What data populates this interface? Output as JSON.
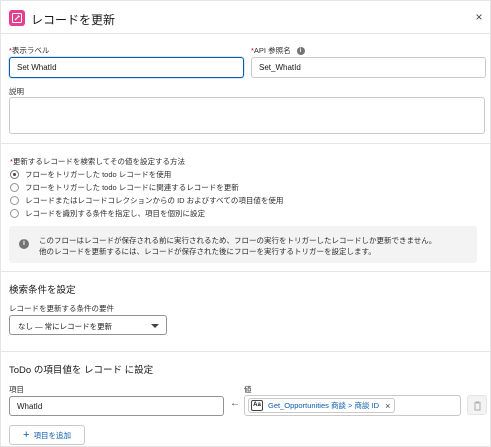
{
  "header": {
    "title": "レコードを更新",
    "close_label": "×"
  },
  "fields": {
    "display_label": {
      "label": "表示ラベル",
      "required_mark": "*",
      "value": "Set WhatId"
    },
    "api_name": {
      "label": "API 参照名",
      "required_mark": "*",
      "value": "Set_WhatId"
    },
    "description": {
      "label": "説明",
      "value": ""
    }
  },
  "method": {
    "label": "更新するレコードを検索してその値を設定する方法",
    "required_mark": "*",
    "options": [
      {
        "label": "フローをトリガーした todo レコードを使用",
        "selected": true
      },
      {
        "label": "フローをトリガーした todo レコードに関連するレコードを更新",
        "selected": false
      },
      {
        "label": "レコードまたはレコードコレクションからの ID およびすべての項目値を使用",
        "selected": false
      },
      {
        "label": "レコードを識別する条件を指定し、項目を個別に設定",
        "selected": false
      }
    ]
  },
  "info": {
    "line1": "このフローはレコードが保存される前に実行されるため、フローの実行をトリガーしたレコードしか更新できません。",
    "line2": "他のレコードを更新するには、レコードが保存された後にフローを実行するトリガーを設定します。"
  },
  "filter_section": {
    "title": "検索条件を設定",
    "requirement_label": "レコードを更新する条件の要件",
    "requirement_value": "なし — 常にレコードを更新"
  },
  "values_section": {
    "title": "ToDo の項目値を レコード に設定",
    "field_label": "項目",
    "value_label": "値",
    "rows": [
      {
        "field": "WhatId",
        "value": "Get_Opportunities 商談 > 商談 ID"
      }
    ],
    "value_icon_text": "Aa",
    "add_button": "項目を追加"
  }
}
